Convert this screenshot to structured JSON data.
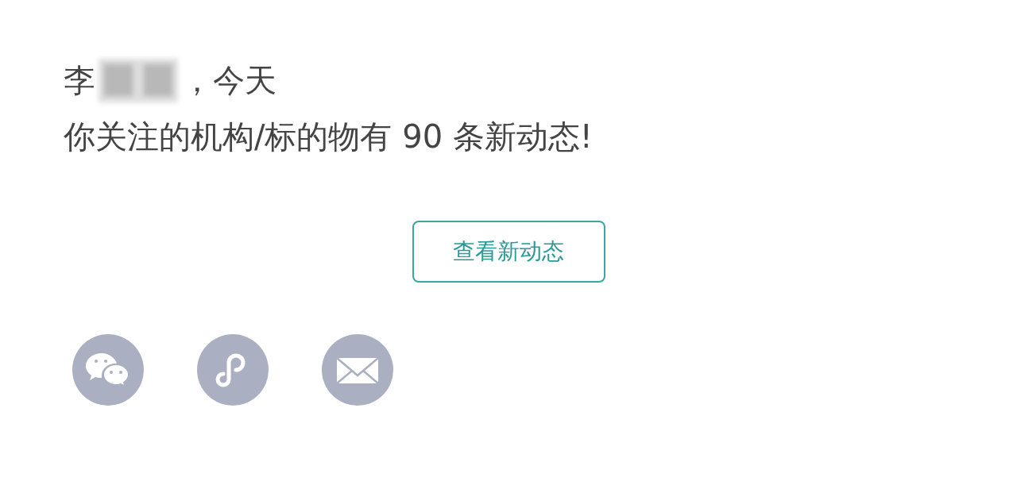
{
  "greeting": {
    "surname": "李",
    "suffix": "，今天"
  },
  "message": "你关注的机构/标的物有 90 条新动态!",
  "button": {
    "label": "查看新动态"
  },
  "share_buttons": [
    {
      "kind": "wechat"
    },
    {
      "kind": "miniprogram"
    },
    {
      "kind": "email"
    }
  ]
}
